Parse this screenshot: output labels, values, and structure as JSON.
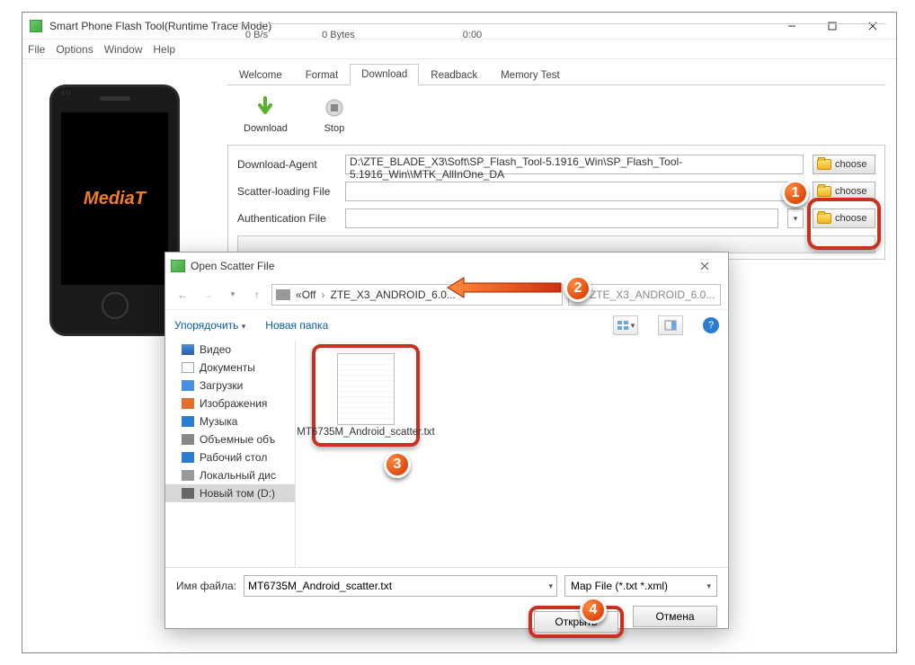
{
  "window": {
    "title": "Smart Phone Flash Tool(Runtime Trace Mode)"
  },
  "menu": {
    "file": "File",
    "options": "Options",
    "window": "Window",
    "help": "Help"
  },
  "tabs": {
    "welcome": "Welcome",
    "format": "Format",
    "download": "Download",
    "readback": "Readback",
    "memory_test": "Memory Test"
  },
  "toolbar": {
    "download": "Download",
    "stop": "Stop"
  },
  "fields": {
    "da_label": "Download-Agent",
    "da_value": "D:\\ZTE_BLADE_X3\\Soft\\SP_Flash_Tool-5.1916_Win\\SP_Flash_Tool-5.1916_Win\\\\MTK_AllInOne_DA",
    "scatter_label": "Scatter-loading File",
    "scatter_value": "",
    "auth_label": "Authentication File",
    "auth_value": "",
    "choose": "choose"
  },
  "phone_brand": "MediaT",
  "phone_bm": "BM",
  "dialog": {
    "title": "Open Scatter File",
    "crumb1": "Off",
    "crumb2": "ZTE_X3_ANDROID_6.0...",
    "crumb_prefix": "«",
    "search_placeholder": "ZTE_X3_ANDROID_6.0...",
    "organize": "Упорядочить",
    "new_folder": "Новая папка",
    "tree": {
      "video": "Видео",
      "documents": "Документы",
      "downloads": "Загрузки",
      "images": "Изображения",
      "music": "Музыка",
      "volumes": "Объемные объ",
      "desktop": "Рабочий стол",
      "local_disk": "Локальный дис",
      "new_volume": "Новый том (D:)"
    },
    "file_name": "MT6735M_Android_scatter.txt",
    "file_label": "Имя файла:",
    "filter": "Map File (*.txt *.xml)",
    "open": "Открыть",
    "cancel": "Отмена"
  },
  "status": {
    "speed": "0 B/s",
    "bytes": "0 Bytes",
    "time": "0:00"
  },
  "badges": {
    "b1": "1",
    "b2": "2",
    "b3": "3",
    "b4": "4"
  },
  "search_icon_label": "🔍"
}
